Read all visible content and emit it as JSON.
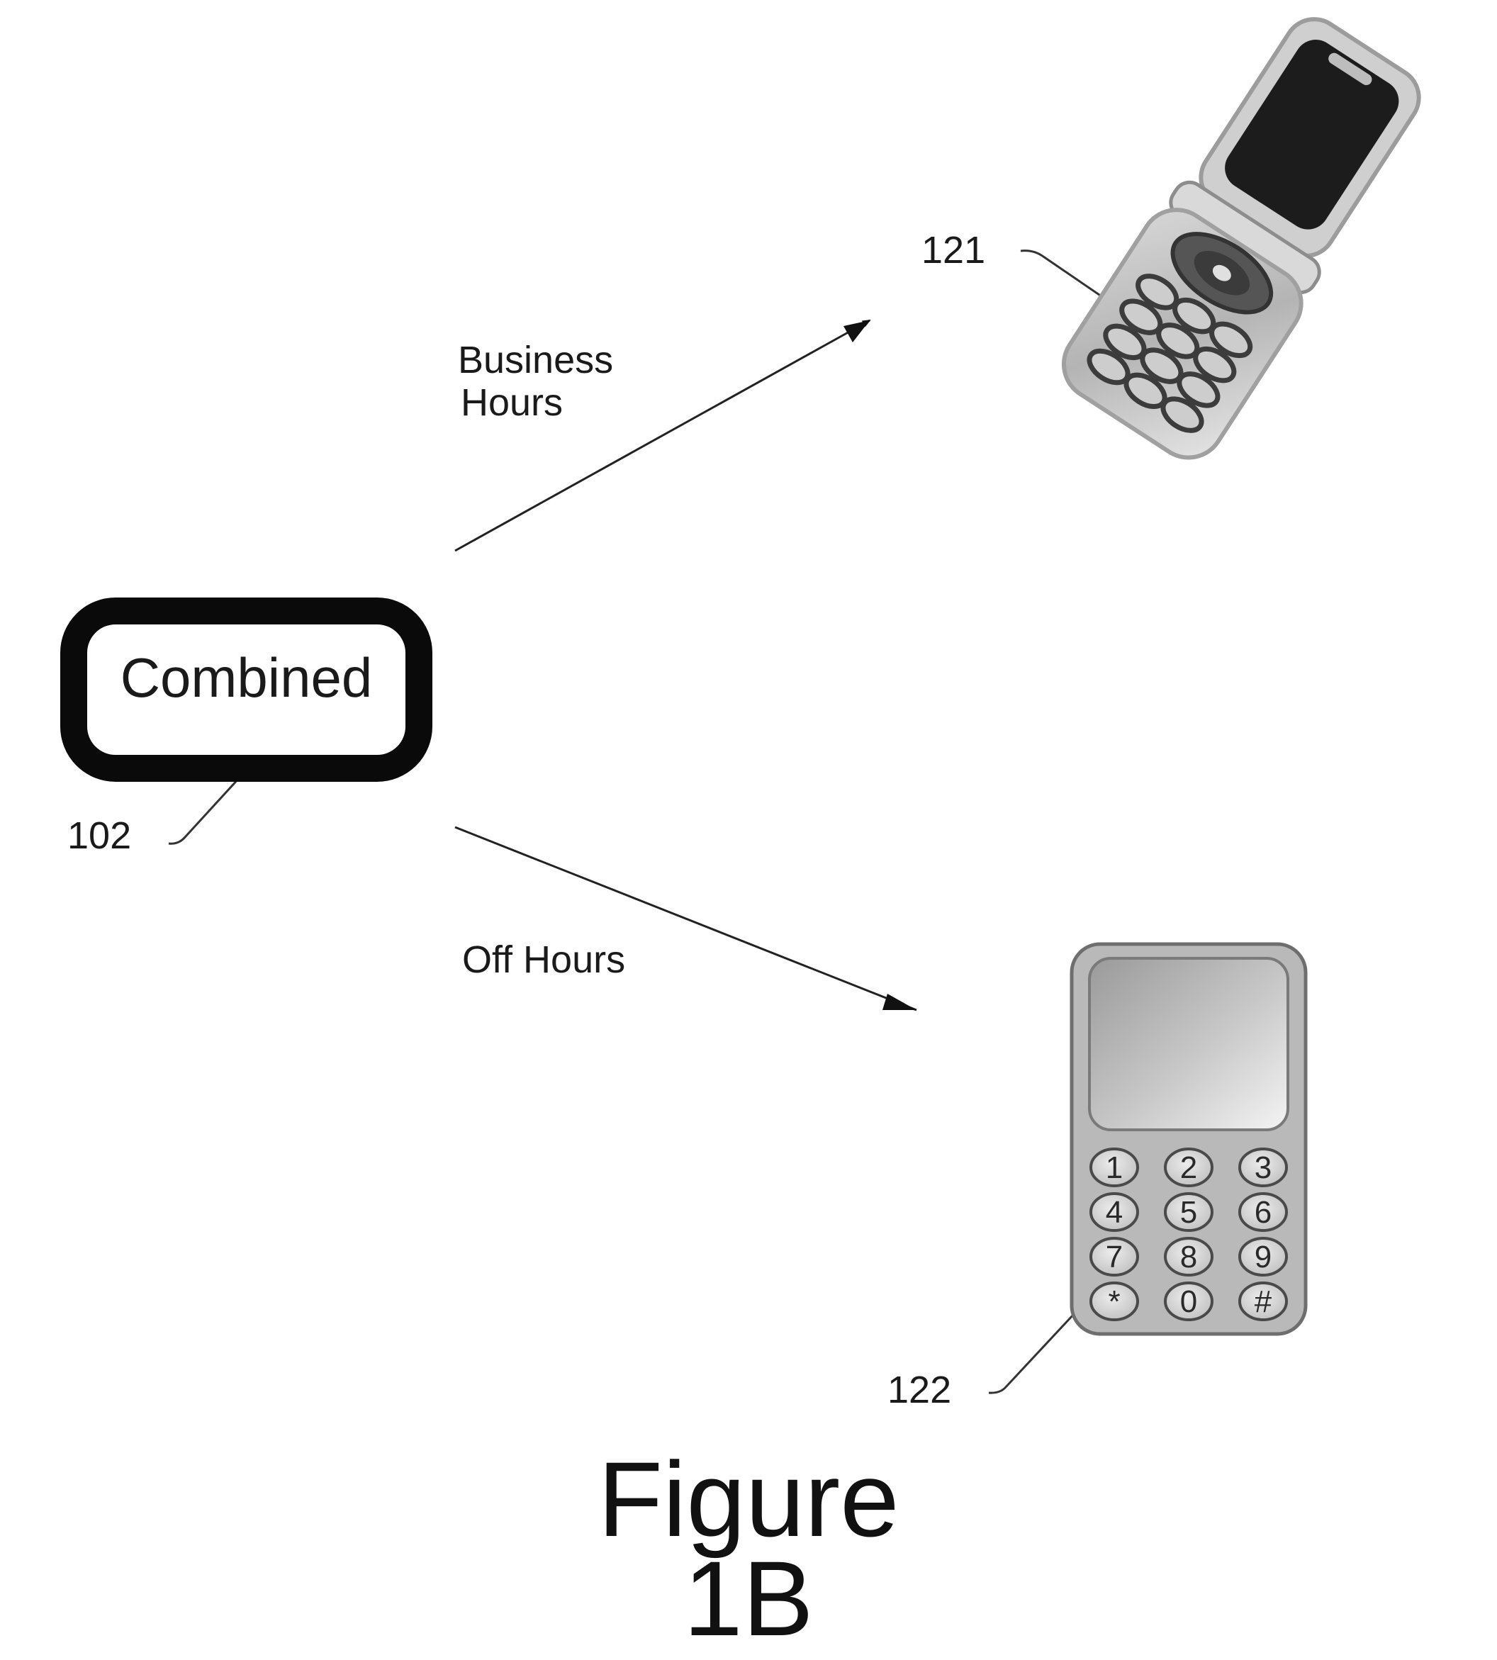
{
  "figure": {
    "caption_line1": "Figure",
    "caption_line2": "1B"
  },
  "nodes": {
    "combined": {
      "label": "Combined",
      "ref": "102"
    },
    "flip_phone": {
      "ref": "121",
      "icon": "flip-phone-icon"
    },
    "candybar_phone": {
      "ref": "122",
      "icon": "candybar-phone-icon",
      "keypad": [
        "1",
        "2",
        "3",
        "4",
        "5",
        "6",
        "7",
        "8",
        "9",
        "*",
        "0",
        "#"
      ]
    }
  },
  "edges": {
    "business": {
      "label_line1": "Business",
      "label_line2": "Hours",
      "from": "Combined",
      "to": "121"
    },
    "off": {
      "label": "Off Hours",
      "from": "Combined",
      "to": "122"
    }
  }
}
